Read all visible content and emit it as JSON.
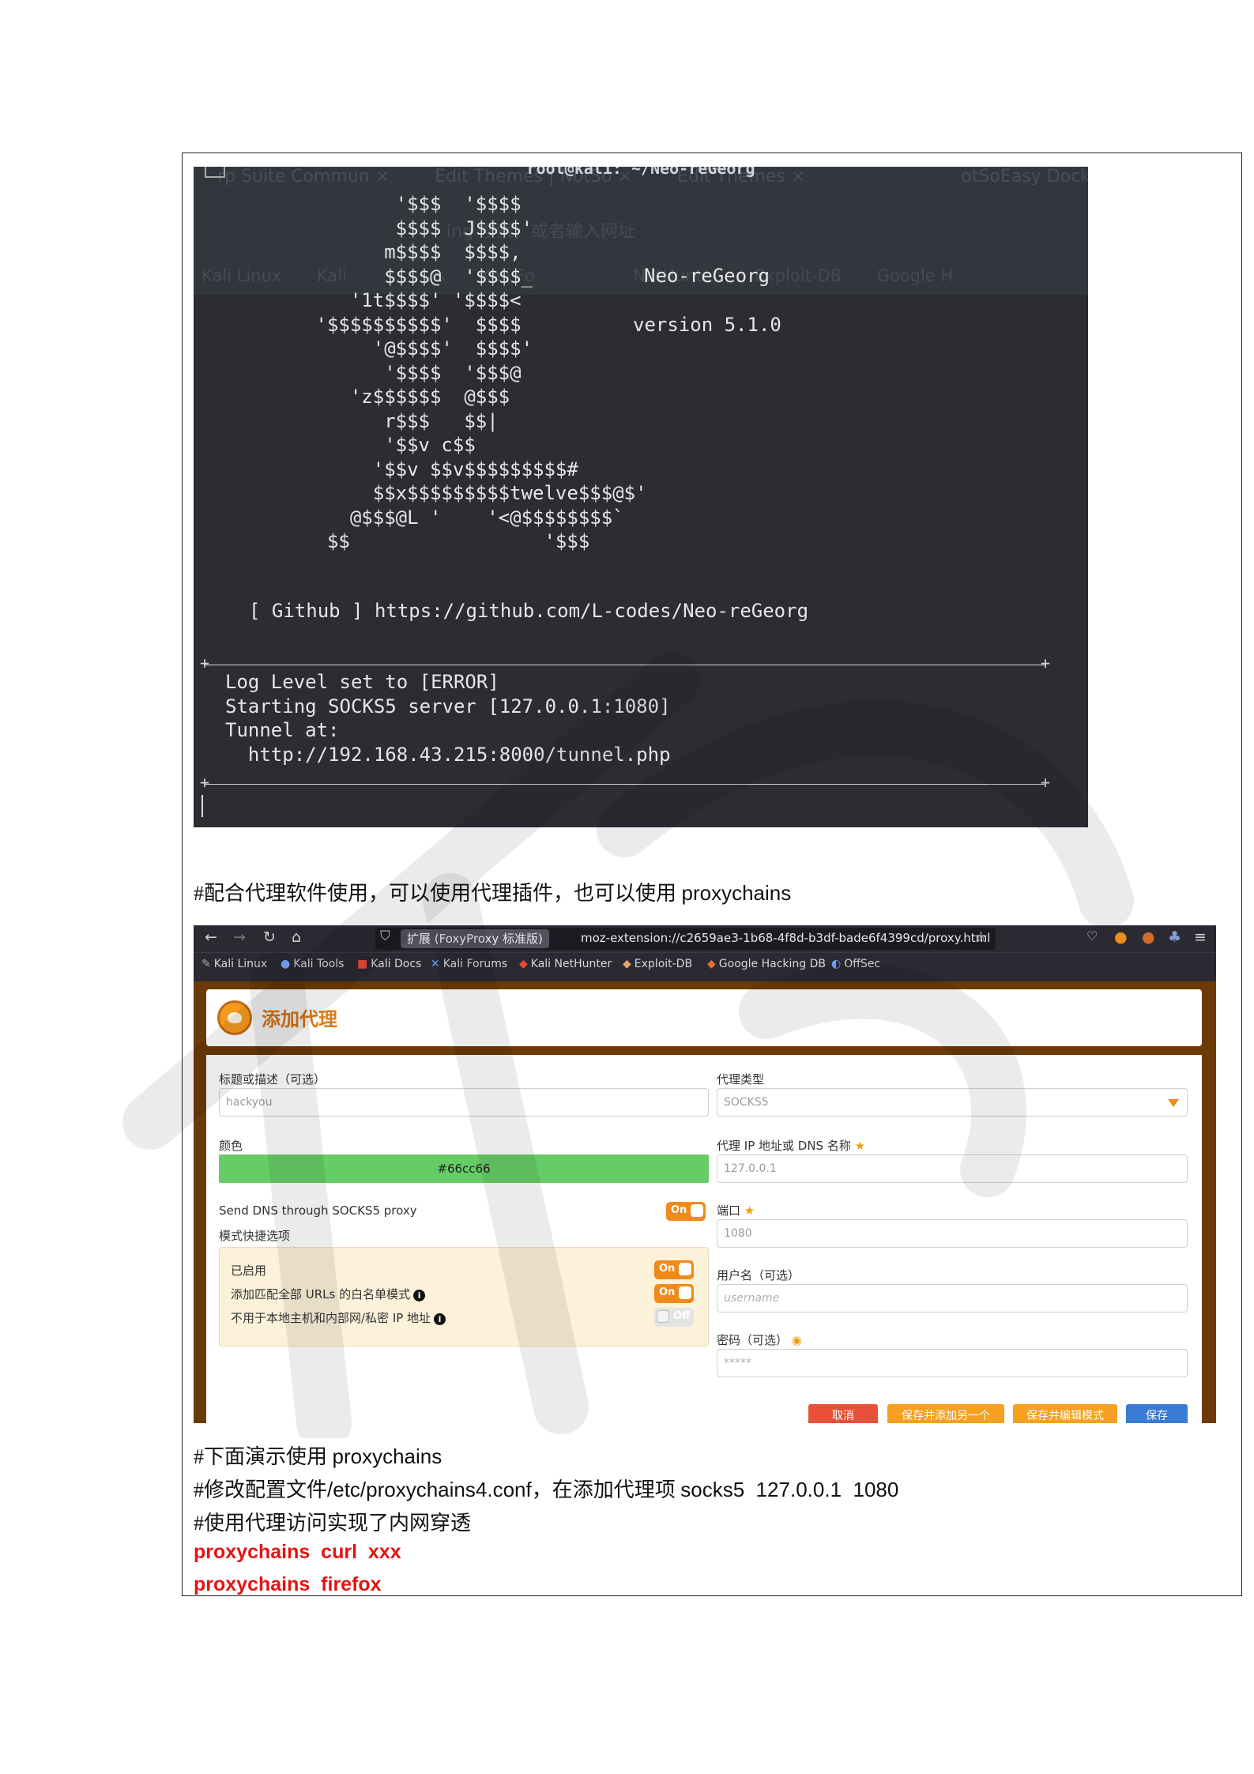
{
  "terminal": {
    "title": "root@kali: ~/Neo-reGeorg",
    "ghost_tabs": [
      "rp Suite Commun ×",
      "Edit Themes | NotSo ×",
      "Edit Themes ×",
      "otSoEasy Docke"
    ],
    "ghost_url": "ing 搜索，或者输入网址",
    "ghost_bookmarks": [
      "Kali Linux",
      "Kali",
      "rs",
      "Kali Fo",
      "NetHunter",
      "Exploit-DB",
      "Google H"
    ],
    "ascii_lines": [
      "                 '$$$  '$$$$",
      "                 $$$$  J$$$$'",
      "                m$$$$  $$$$,",
      "                $$$$@  '$$$$_",
      "             '1t$$$$' '$$$$<",
      "          '$$$$$$$$$$'  $$$$",
      "               '@$$$$'  $$$$'",
      "                '$$$$  '$$$@",
      "             'z$$$$$$  @$$$",
      "                r$$$   $$|",
      "                '$$v c$$",
      "               '$$v $$v$$$$$$$$$#",
      "               $$x$$$$$$$$$twelve$$$@$'",
      "             @$$$@L '    '<@$$$$$$$$`",
      "           $$                 '$$$"
    ],
    "app_name": "Neo-reGeorg",
    "version": "version 5.1.0",
    "github_line": "[ Github ] https://github.com/L-codes/Neo-reGeorg",
    "log_lines": [
      "Log Level set to [ERROR]",
      "Starting SOCKS5 server [127.0.0.1:1080]",
      "Tunnel at:",
      "  http://192.168.43.215:8000/tunnel.php"
    ]
  },
  "doc": {
    "line1_cn": "#配合代理软件使用，可以使用代理插件，也可以使用 ",
    "line1_latin": "proxychains",
    "line2_cn": "#下面演示使用 ",
    "line2_latin": "proxychains",
    "line3_cn_a": "#修改配置文件",
    "line3_latin_a": "/etc/proxychains4.conf",
    "line3_cn_b": "，在添加代理项 ",
    "line3_latin_b": "socks5  127.0.0.1  1080",
    "line4": "#使用代理访问实现了内网穿透",
    "cmd1": "proxychains  curl  xxx",
    "cmd2": "proxychains  firefox"
  },
  "browser": {
    "ext_chip": "扩展 (FoxyProxy 标准版)",
    "url": "moz-extension://c2659ae3-1b68-4f8d-b3df-bade6f4399cd/proxy.html",
    "bookmarks": [
      "Kali Linux",
      "Kali Tools",
      "Kali Docs",
      "Kali Forums",
      "Kali NetHunter",
      "Exploit-DB",
      "Google Hacking DB",
      "OffSec"
    ]
  },
  "form": {
    "header_title": "添加代理",
    "title_label": "标题或描述（可选）",
    "title_value": "hackyou",
    "color_label": "颜色",
    "color_value": "#66cc66",
    "dns_label": "Send DNS through SOCKS5 proxy",
    "dns_toggle": "On",
    "mode_label": "模式快捷选项",
    "enabled_label": "已启用",
    "enabled_toggle": "On",
    "whitelist_label": "添加匹配全部 URLs 的白名单模式",
    "whitelist_toggle": "On",
    "local_label": "不用于本地主机和内部网/私密 IP 地址",
    "local_toggle": "Off",
    "type_label": "代理类型",
    "type_value": "SOCKS5",
    "ip_label": "代理 IP 地址或 DNS 名称",
    "ip_value": "127.0.0.1",
    "port_label": "端口",
    "port_value": "1080",
    "user_label": "用户名（可选）",
    "user_placeholder": "username",
    "pass_label": "密码（可选）",
    "pass_placeholder": "*****",
    "btn_cancel": "取消",
    "btn_save_add": "保存并添加另一个",
    "btn_save_edit": "保存并编辑模式",
    "btn_save": "保存",
    "colors": {
      "accent": "#f08a1a",
      "cancel": "#e8503a",
      "save": "#3a7bd5",
      "frame": "#6b3a05"
    }
  }
}
